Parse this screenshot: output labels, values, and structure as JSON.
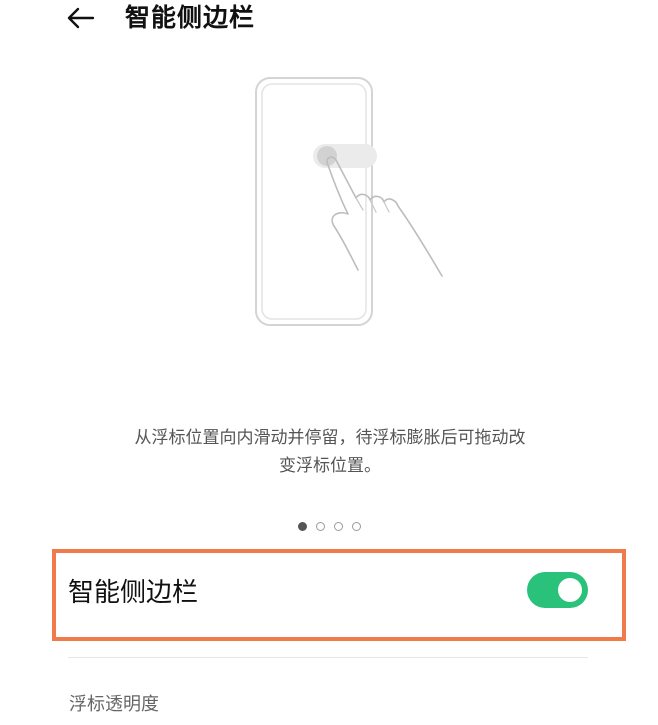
{
  "header": {
    "title": "智能侧边栏",
    "back_icon": "arrow-left-icon"
  },
  "illustration": {
    "icon": "phone-swipe-gesture-illustration"
  },
  "description": {
    "line1": "从浮标位置向内滑动并停留，待浮标膨胀后可拖动改",
    "line2": "变浮标位置。"
  },
  "pager": {
    "current_page": 1,
    "total_pages": 4
  },
  "setting": {
    "label": "智能侧边栏",
    "enabled": true,
    "toggle_color": "#2ac27a",
    "highlight_color": "#f07a4a"
  },
  "section": {
    "label": "浮标透明度"
  }
}
